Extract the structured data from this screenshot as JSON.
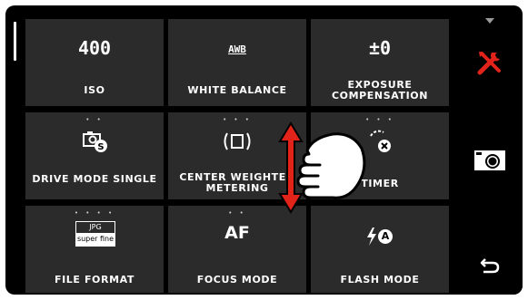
{
  "menu": {
    "tiles": [
      {
        "value": "400",
        "label": "ISO"
      },
      {
        "value": "AWB",
        "label": "WHITE BALANCE"
      },
      {
        "value": "±0",
        "label": "EXPOSURE COMPENSATION"
      },
      {
        "value": "",
        "label": "DRIVE MODE SINGLE",
        "dots": "• •"
      },
      {
        "value": "",
        "label": "CENTER WEIGHTED METERING",
        "dots": "• • •"
      },
      {
        "value": "",
        "label": "TIMER",
        "dots": "• • •"
      },
      {
        "value": "",
        "label": "FILE FORMAT",
        "dots": "• • • •",
        "icon_text_top": "JPG",
        "icon_text_bottom": "super fine"
      },
      {
        "value": "AF",
        "label": "FOCUS MODE",
        "dots": "• •"
      },
      {
        "value": "A",
        "label": "FLASH MODE"
      }
    ]
  },
  "sidebar": {
    "items": [
      {
        "icon": "caret-down-icon"
      },
      {
        "icon": "tools-icon",
        "color": "#e2231a"
      },
      {
        "icon": "camera-icon"
      },
      {
        "icon": "back-arrow-icon"
      }
    ]
  },
  "overlay": {
    "gesture": "vertical-swipe-hand-icon",
    "arrow_color": "#e2231a"
  }
}
